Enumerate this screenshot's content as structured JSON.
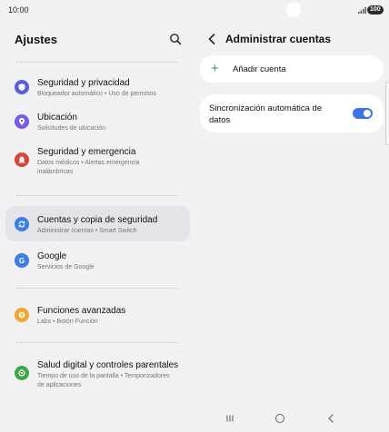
{
  "status_bar": {
    "time": "10:00",
    "battery": "100"
  },
  "left_panel": {
    "title": "Ajustes",
    "items": [
      {
        "title": "Seguridad y privacidad",
        "subtitle": "Bloqueador automático • Uso de permisos",
        "icon": "shield-icon",
        "color": "#5b5fd7"
      },
      {
        "title": "Ubicación",
        "subtitle": "Solicitudes de ubicación",
        "icon": "location-pin-icon",
        "color": "#7a5ce0"
      },
      {
        "title": "Seguridad y emergencia",
        "subtitle": "Datos médicos • Alertas emergencia inalámbricas",
        "icon": "emergency-bell-icon",
        "color": "#d8453a"
      },
      {
        "title": "Cuentas y copia de seguridad",
        "subtitle": "Administrar cuentas • Smart Switch",
        "icon": "sync-icon",
        "color": "#3a7ee8"
      },
      {
        "title": "Google",
        "subtitle": "Servicios de Google",
        "icon": "google-g-icon",
        "color": "#3a7ee8"
      },
      {
        "title": "Funciones avanzadas",
        "subtitle": "Labs • Botón Función",
        "icon": "star-gear-icon",
        "color": "#f0a634"
      },
      {
        "title": "Salud digital y controles parentales",
        "subtitle": "Tiempo de uso de la pantalla • Temporizadores de aplicaciones",
        "icon": "digital-wellbeing-icon",
        "color": "#3fa64c"
      }
    ]
  },
  "right_panel": {
    "title": "Administrar cuentas",
    "add_account": "Añadir cuenta",
    "auto_sync": "Sincronización automática de datos",
    "auto_sync_enabled": true
  },
  "colors": {
    "accent": "#3a75e8",
    "add_plus": "#3aa057"
  }
}
